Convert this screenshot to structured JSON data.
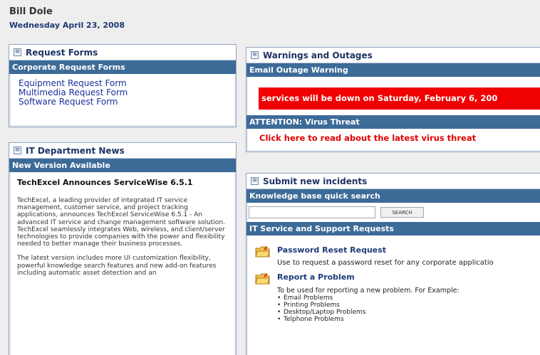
{
  "header": {
    "user_name": "Bill Dole",
    "date": "Wednesday April 23, 2008"
  },
  "request_forms": {
    "title": "Request Forms",
    "section": "Corporate Request Forms",
    "links": [
      "Equipment Request Form",
      "Multimedia Request Form",
      "Software Request Form"
    ]
  },
  "it_news": {
    "title": "IT Department News",
    "section": "New Version Available",
    "headline": "TechExcel Announces ServiceWise 6.5.1",
    "paragraph1": "TechExcel, a leading provider of integrated IT service management, customer service, and project tracking applications, announces TechExcel ServiceWise 6.5.1 - An advanced IT service and change management software solution. TechExcel seamlessly integrates Web, wireless, and client/server technologies to provide companies with the power and flexibility needed to better manage their business processes.",
    "paragraph2": "The latest version includes more UI customization flexibility, powerful knowledge search features and new add-on features including automatic asset detection and an"
  },
  "warnings": {
    "title": "Warnings and Outages",
    "email_section": "Email Outage Warning",
    "email_message": "services will be down on Saturday, February 6, 200",
    "virus_section": "ATTENTION: Virus Threat",
    "virus_link": "Click here to read about the latest virus threat"
  },
  "incidents": {
    "title": "Submit new incidents",
    "kb_section": "Knowledge base quick search",
    "search_value": "",
    "search_button": "SEARCH",
    "requests_section": "IT Service and Support Requests",
    "password": {
      "title": "Password Reset Request",
      "desc": "Use to request a password reset for any corporate applicatio"
    },
    "problem": {
      "title": "Report a Problem",
      "desc": "To be used for reporting a new problem. For Example:",
      "examples": [
        "Email Problems",
        "Printing Problems",
        "Desktop/Laptop Problems",
        "Telphone Problems"
      ]
    }
  },
  "colors": {
    "section_bar": "#3d6b98",
    "outage_red": "#f00000",
    "link_blue": "#1d2f9c",
    "date_blue": "#1f3a73"
  }
}
